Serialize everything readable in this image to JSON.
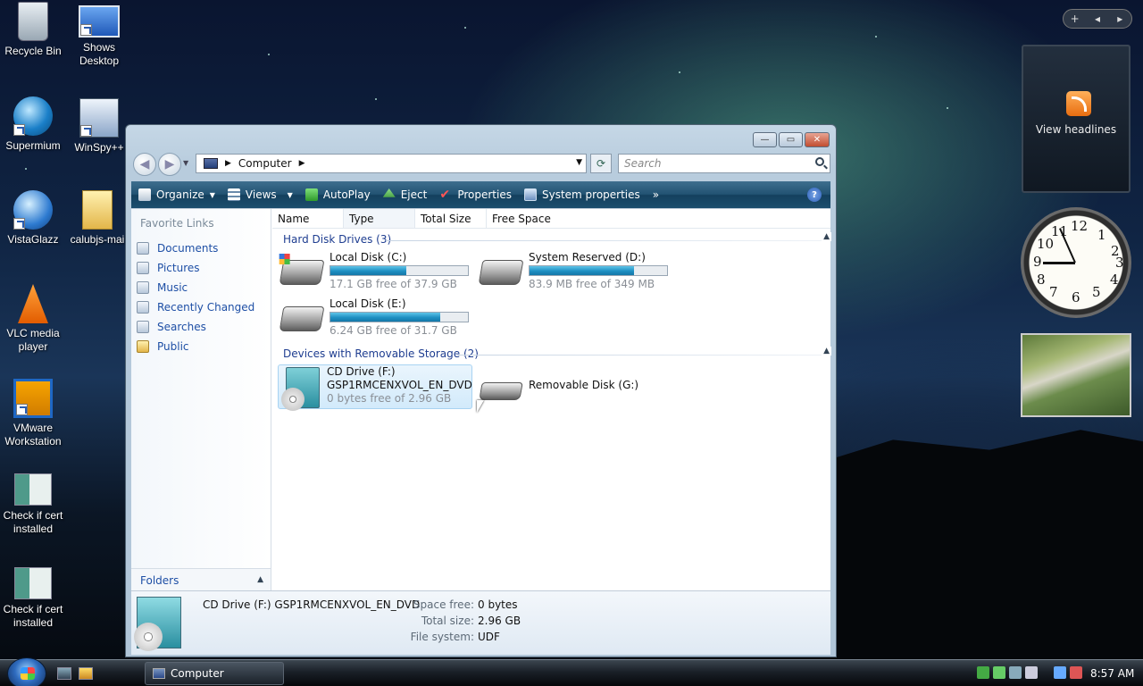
{
  "desktop": {
    "icons": [
      {
        "label": "Recycle Bin"
      },
      {
        "label": "Shows Desktop"
      },
      {
        "label": "Supermium"
      },
      {
        "label": "WinSpy++"
      },
      {
        "label": "VistaGlazz"
      },
      {
        "label": "calubjs-mai"
      },
      {
        "label": "VLC media player"
      },
      {
        "label": "VMware Workstation"
      },
      {
        "label": "Check if cert installed"
      },
      {
        "label": "Check if cert installed"
      }
    ]
  },
  "window": {
    "address": {
      "location": "Computer"
    },
    "search": {
      "placeholder": "Search"
    },
    "toolbar": {
      "organize": "Organize",
      "views": "Views",
      "autoplay": "AutoPlay",
      "eject": "Eject",
      "properties": "Properties",
      "system_properties": "System properties",
      "more": "»"
    },
    "nav": {
      "title": "Favorite Links",
      "links": [
        "Documents",
        "Pictures",
        "Music",
        "Recently Changed",
        "Searches",
        "Public"
      ],
      "folders": "Folders"
    },
    "columns": [
      "Name",
      "Type",
      "Total Size",
      "Free Space"
    ],
    "groups": [
      {
        "title": "Hard Disk Drives (3)",
        "drives": [
          {
            "name": "Local Disk (C:)",
            "free": "17.1 GB free of 37.9 GB",
            "used_fraction": 0.55
          },
          {
            "name": "System Reserved (D:)",
            "free": "83.9 MB free of 349 MB",
            "used_fraction": 0.76
          },
          {
            "name": "Local Disk (E:)",
            "free": "6.24 GB free of 31.7 GB",
            "used_fraction": 0.8
          }
        ]
      },
      {
        "title": "Devices with Removable Storage (2)",
        "drives": [
          {
            "name": "CD Drive (F:)",
            "label": "GSP1RMCENXVOL_EN_DVD",
            "free": "0 bytes free of 2.96 GB"
          },
          {
            "name": "Removable Disk (G:)"
          }
        ]
      }
    ],
    "details": {
      "title": "CD Drive (F:) GSP1RMCENXVOL_EN_DVD",
      "space_free_label": "Space free:",
      "space_free": "0 bytes",
      "total_size_label": "Total size:",
      "total_size": "2.96 GB",
      "file_system_label": "File system:",
      "file_system": "UDF"
    }
  },
  "sidebar": {
    "controls": {
      "add": "+",
      "prev": "◂",
      "next": "▸"
    },
    "feed": {
      "label": "View headlines"
    },
    "clock": {
      "numbers": [
        "12",
        "1",
        "2",
        "3",
        "4",
        "5",
        "6",
        "7",
        "8",
        "9",
        "10",
        "11"
      ]
    }
  },
  "taskbar": {
    "task": "Computer",
    "time": "8:57 AM"
  }
}
